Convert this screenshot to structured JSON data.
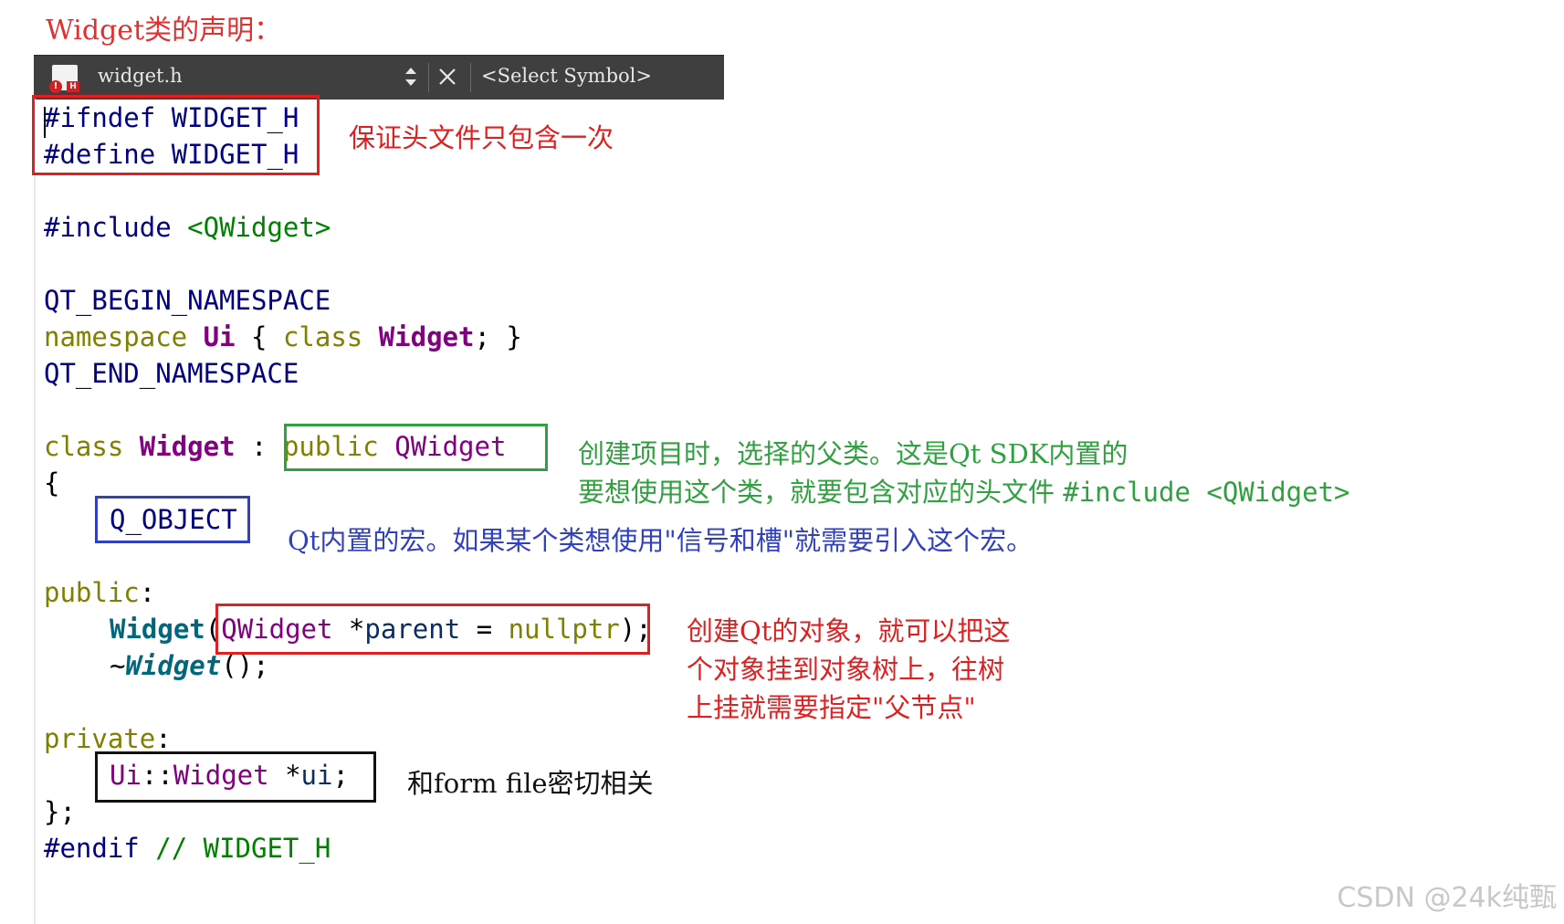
{
  "page_title": "Widget类的声明：",
  "toolbar": {
    "file_icon": "header-file-icon",
    "filename": "widget.h",
    "updown_icon": "up-down-arrows-icon",
    "close_icon": "close-icon",
    "symbol_selector": "<Select Symbol>"
  },
  "code": {
    "l1_dir": "#ifndef",
    "l1_macro": "WIDGET_H",
    "l2_dir": "#define",
    "l2_macro": "WIDGET_H",
    "l3_dir": "#include",
    "l3_header": "<QWidget>",
    "l4": "QT_BEGIN_NAMESPACE",
    "l5_kw": "namespace",
    "l5_ns": "Ui",
    "l5_open": "{",
    "l5_kw2": "class",
    "l5_cls": "Widget",
    "l5_close": "; }",
    "l6": "QT_END_NAMESPACE",
    "l7_kw": "class",
    "l7_cls": "Widget",
    "l7_colon": ":",
    "l7_public": "public",
    "l7_base": "QWidget",
    "l8": "{",
    "l9": "Q_OBJECT",
    "l10_kw": "public",
    "l10_colon": ":",
    "l11_ctor": "Widget",
    "l11_lparen": "(",
    "l11_type": "QWidget",
    "l11_star": "*",
    "l11_param": "parent",
    "l11_eq": "=",
    "l11_null": "nullptr",
    "l11_end": ");",
    "l12_tilde": "~",
    "l12_dtor": "Widget",
    "l12_end": "();",
    "l13_kw": "private",
    "l13_colon": ":",
    "l14_ns": "Ui",
    "l14_sep": "::",
    "l14_cls": "Widget",
    "l14_star": "*",
    "l14_var": "ui",
    "l14_semi": ";",
    "l15": "};",
    "l16_dir": "#endif",
    "l16_comment": "// WIDGET_H"
  },
  "notes": {
    "guard": "保证头文件只包含一次",
    "base_line1": "创建项目时，选择的父类。这是Qt SDK内置的",
    "base_line2": "要想使用这个类，就要包含对应的头文件",
    "base_line2_code": "#include <QWidget>",
    "qobject": "Qt内置的宏。如果某个类想使用\"信号和槽\"就需要引入这个宏。",
    "ctor_line1": "创建Qt的对象，就可以把这",
    "ctor_line2": "个对象挂到对象树上，往树",
    "ctor_line3": "上挂就需要指定\"父节点\"",
    "ui": "和form file密切相关"
  },
  "watermark": "CSDN @24k纯甄"
}
